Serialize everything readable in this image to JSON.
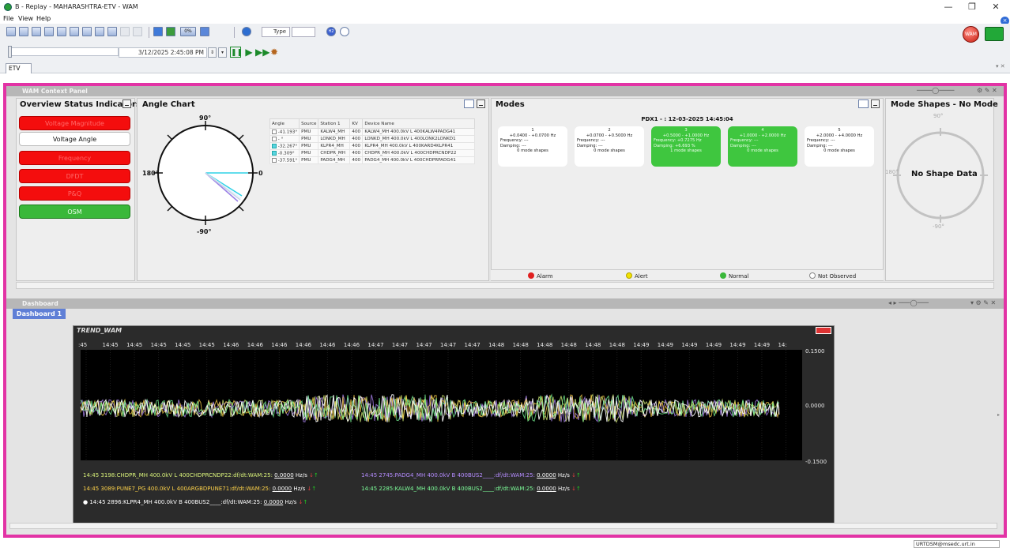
{
  "window": {
    "title": "B - Replay - MAHARASHTRA-ETV - WAM",
    "minimize": "—",
    "maximize": "❐",
    "close": "✕"
  },
  "menu": [
    "File",
    "View",
    "Help"
  ],
  "toolbar": {
    "zoom_label": "0%",
    "type_label": "Type",
    "h2_label": "H2",
    "wam_badge": "WAM"
  },
  "playback": {
    "datetime": "3/12/2025 2:45:08 PM"
  },
  "tabs": {
    "active": "ETV"
  },
  "context_panel": {
    "title": "WAM Context Panel",
    "overview": {
      "title": "Overview Status Indicators",
      "indicators": [
        {
          "label": "Voltage Magnitude",
          "state": "red"
        },
        {
          "label": "Voltage Angle",
          "state": "white"
        },
        {
          "label": "Frequency",
          "state": "red"
        },
        {
          "label": "DFDT",
          "state": "red"
        },
        {
          "label": "P&Q",
          "state": "red"
        },
        {
          "label": "OSM",
          "state": "green"
        }
      ]
    },
    "angle_chart": {
      "title": "Angle Chart",
      "labels": {
        "top": "90°",
        "bottom": "-90°",
        "left": "180°",
        "right": "0"
      },
      "columns": [
        "Angle",
        "Source",
        "Station 1",
        "KV",
        "Device Name"
      ],
      "rows": [
        [
          "-41.193°",
          "PMU",
          "KALW4_MH",
          "400",
          "KALW4_MH 400.0kV L 400KALW4PADG41"
        ],
        [
          "- °",
          "PMU",
          "LONKD_MH",
          "400",
          "LONKD_MH 400.0kV L 400LONK2LONKD1"
        ],
        [
          "-32.267°",
          "PMU",
          "KLPR4_MH",
          "400",
          "KLPR4_MH 400.0kV L 400KARD4KLPR41"
        ],
        [
          "-0.309°",
          "PMU",
          "CHDPR_MH",
          "400",
          "CHDPR_MH 400.0kV L 400CHDPRCNDP22"
        ],
        [
          "-37.591°",
          "PMU",
          "PADG4_MH",
          "400",
          "PADG4_MH 400.0kV L 400CHDPRPADG41"
        ]
      ]
    },
    "modes": {
      "title": "Modes",
      "subtitle": "PDX1 - : 12-03-2025 14:45:04",
      "cards": [
        {
          "num": "1",
          "range": "+0.0400 - +0.0700 Hz",
          "freq": "---",
          "damp": "---",
          "shapes": "0 mode shapes",
          "color": "white"
        },
        {
          "num": "2",
          "range": "+0.0700 - +0.5000 Hz",
          "freq": "---",
          "damp": "---",
          "shapes": "0 mode shapes",
          "color": "white"
        },
        {
          "num": "3",
          "range": "+0.5000 - +1.0000 Hz",
          "freq": "+0.7275 Hz",
          "damp": "+6.693 %",
          "shapes": "1 mode shapes",
          "color": "green"
        },
        {
          "num": "4",
          "range": "+1.0000 - +2.0000 Hz",
          "freq": "---",
          "damp": "---",
          "shapes": "0 mode shapes",
          "color": "green"
        },
        {
          "num": "5",
          "range": "+2.0000 - +4.0000 Hz",
          "freq": "---",
          "damp": "---",
          "shapes": "0 mode shapes",
          "color": "white"
        }
      ],
      "freq_label": "Frequency:",
      "damp_label": "Damping:",
      "legend": [
        {
          "label": "Alarm",
          "color": "#e02020"
        },
        {
          "label": "Alert",
          "color": "#f2e200"
        },
        {
          "label": "Normal",
          "color": "#3ab83a"
        },
        {
          "label": "Not Observed",
          "color": "#ffffff"
        }
      ]
    },
    "mode_shapes": {
      "title": "Mode Shapes - No Mode",
      "empty": "No Shape Data",
      "labels": {
        "top": "90°",
        "bottom": "-90°",
        "left": "180°"
      }
    }
  },
  "dashboard": {
    "title": "Dashboard",
    "tab": "Dashboard 1",
    "trend": {
      "title": "TREND_WAM",
      "time_ticks": [
        ":45",
        "14:45",
        "14:45",
        "14:45",
        "14:45",
        "14:45",
        "14:46",
        "14:46",
        "14:46",
        "14:46",
        "14:46",
        "14:46",
        "14:47",
        "14:47",
        "14:47",
        "14:47",
        "14:47",
        "14:48",
        "14:48",
        "14:48",
        "14:48",
        "14:48",
        "14:48",
        "14:49",
        "14:49",
        "14:49",
        "14:49",
        "14:49",
        "14:49",
        "14:"
      ],
      "y_ticks": [
        "0.1500",
        "0.0000",
        "-0.1500"
      ],
      "legend": [
        {
          "time": "14:45",
          "text": "3198:CHDPR_MH 400.0kV L 400CHDPRCNDP22:df/dt:WAM:25:",
          "value": "0.0000",
          "unit": "Hz/s",
          "color": "#d9f27a"
        },
        {
          "time": "14:45",
          "text": "2745:PADG4_MH 400.0kV B 400BUS2____:df/dt:WAM:25:",
          "value": "0.0000",
          "unit": "Hz/s",
          "color": "#b58cff"
        },
        {
          "time": "14:45",
          "text": "3089:PUNE7_PG 400.0kV L 400ARGBDPUNE71:df/dt:WAM:25:",
          "value": "0.0000",
          "unit": "Hz/s",
          "color": "#ffd34a"
        },
        {
          "time": "14:45",
          "text": "2285:KALW4_MH 400.0kV B 400BUS2____:df/dt:WAM:25:",
          "value": "0.0000",
          "unit": "Hz/s",
          "color": "#7dff9a"
        },
        {
          "time": "14:45",
          "text": "2896:KLPR4_MH 400.0kV B 400BUS2____:df/dt:WAM:25:",
          "value": "0.0000",
          "unit": "Hz/s",
          "color": "#ffffff"
        }
      ]
    }
  },
  "statusbar": {
    "user": "URTDSM@msedc.urt.in"
  }
}
